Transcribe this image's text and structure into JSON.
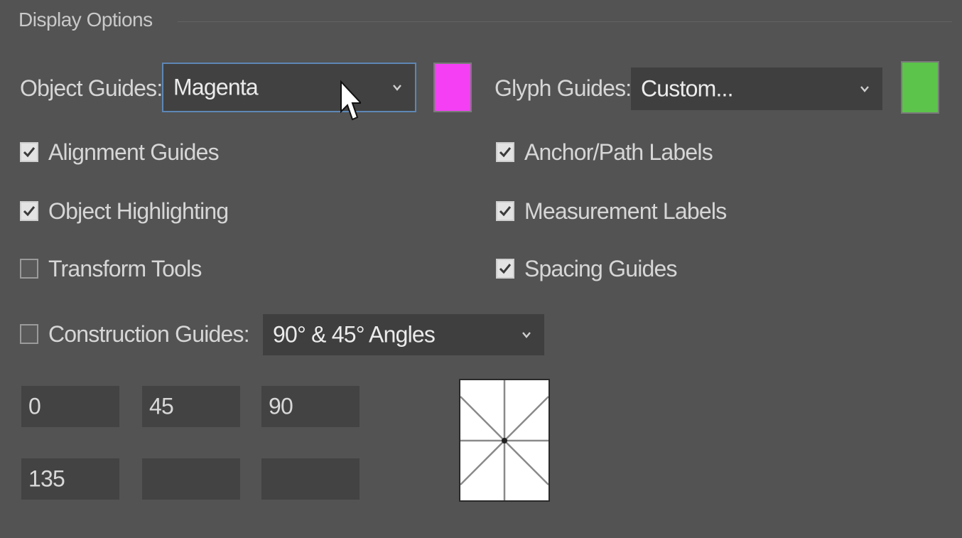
{
  "section": {
    "title": "Display Options"
  },
  "object_guides": {
    "label": "Object Guides:",
    "value": "Magenta",
    "color": "#f53ff5"
  },
  "glyph_guides": {
    "label": "Glyph Guides:",
    "value": "Custom...",
    "color": "#5cc44a"
  },
  "checkboxes": {
    "alignment_guides": {
      "label": "Alignment Guides",
      "checked": true
    },
    "object_highlighting": {
      "label": "Object Highlighting",
      "checked": true
    },
    "transform_tools": {
      "label": "Transform Tools",
      "checked": false
    },
    "anchor_path_labels": {
      "label": "Anchor/Path Labels",
      "checked": true
    },
    "measurement_labels": {
      "label": "Measurement Labels",
      "checked": true
    },
    "spacing_guides": {
      "label": "Spacing Guides",
      "checked": true
    }
  },
  "construction_guides": {
    "label": "Construction Guides:",
    "checked": false,
    "value": "90° & 45° Angles"
  },
  "angle_fields": [
    "0",
    "45",
    "90",
    "135",
    "",
    ""
  ],
  "icons": {
    "dropdown": "chevron-down-icon",
    "check": "checkmark-icon",
    "cursor": "mouse-pointer-icon"
  }
}
